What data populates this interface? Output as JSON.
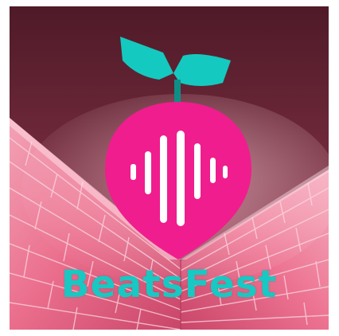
{
  "brand": {
    "name": "BeatsFest"
  },
  "colors": {
    "ceiling_dark": "#5a1f2e",
    "ceiling_light": "#c8707f",
    "wall": "#e8607e",
    "wall_light": "#f7a6b8",
    "tile_line": "#f9d4de",
    "leaf": "#14c9c0",
    "bulb": "#f01d8e",
    "bars": "#ffffff",
    "text": "#18c8c2"
  },
  "logo": {
    "icon": "radish-soundwave-icon",
    "bar_count": 6
  }
}
